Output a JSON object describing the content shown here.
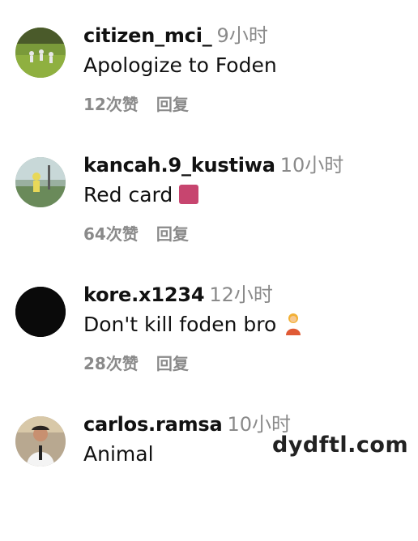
{
  "comments": [
    {
      "username": "citizen_mci_",
      "time": "9小时",
      "text": "Apologize to Foden",
      "likes": "12次赞",
      "reply": "回复",
      "emoji": ""
    },
    {
      "username": "kancah.9_kustiwa",
      "time": "10小时",
      "text": "Red card",
      "likes": "64次赞",
      "reply": "回复",
      "emoji": "red-square"
    },
    {
      "username": "kore.x1234",
      "time": "12小时",
      "text": "Don't kill foden bro",
      "likes": "28次赞",
      "reply": "回复",
      "emoji": "person-gesturing"
    },
    {
      "username": "carlos.ramsa",
      "time": "10小时",
      "text": "Animal",
      "likes": "",
      "reply": "",
      "emoji": ""
    }
  ],
  "watermark": "dydftl.com",
  "colors": {
    "text_primary": "#111111",
    "text_secondary": "#8a8a8a",
    "emoji_red_square": "#c7456f",
    "background": "#ffffff"
  }
}
